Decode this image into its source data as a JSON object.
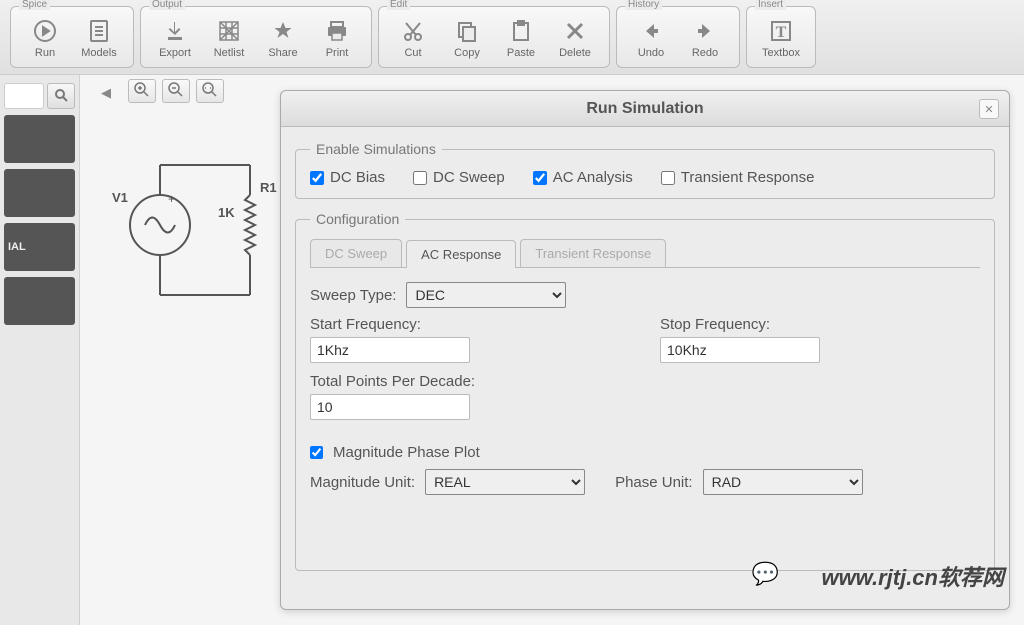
{
  "toolbar": {
    "groups": [
      {
        "label": "Spice",
        "items": [
          {
            "name": "run",
            "label": "Run"
          },
          {
            "name": "models",
            "label": "Models"
          }
        ]
      },
      {
        "label": "Output",
        "items": [
          {
            "name": "export",
            "label": "Export"
          },
          {
            "name": "netlist",
            "label": "Netlist"
          },
          {
            "name": "share",
            "label": "Share"
          },
          {
            "name": "print",
            "label": "Print"
          }
        ]
      },
      {
        "label": "Edit",
        "items": [
          {
            "name": "cut",
            "label": "Cut"
          },
          {
            "name": "copy",
            "label": "Copy"
          },
          {
            "name": "paste",
            "label": "Paste"
          },
          {
            "name": "delete",
            "label": "Delete"
          }
        ]
      },
      {
        "label": "History",
        "items": [
          {
            "name": "undo",
            "label": "Undo"
          },
          {
            "name": "redo",
            "label": "Redo"
          }
        ]
      },
      {
        "label": "Insert",
        "items": [
          {
            "name": "textbox",
            "label": "Textbox"
          }
        ]
      }
    ]
  },
  "sidebar": {
    "search_placeholder": "",
    "items": [
      "",
      "",
      "IAL",
      ""
    ]
  },
  "schematic": {
    "v1_label": "V1",
    "r1_label": "R1",
    "r1_value": "1K"
  },
  "dialog": {
    "title": "Run Simulation",
    "enable_legend": "Enable Simulations",
    "checks": {
      "dc_bias": {
        "label": "DC Bias",
        "checked": true
      },
      "dc_sweep": {
        "label": "DC Sweep",
        "checked": false
      },
      "ac_analysis": {
        "label": "AC Analysis",
        "checked": true
      },
      "transient": {
        "label": "Transient Response",
        "checked": false
      }
    },
    "config_legend": "Configuration",
    "tabs": {
      "dc_sweep": "DC Sweep",
      "ac_response": "AC Response",
      "transient": "Transient Response"
    },
    "sweep_type_label": "Sweep Type:",
    "sweep_type_value": "DEC",
    "start_freq_label": "Start Frequency:",
    "start_freq_value": "1Khz",
    "stop_freq_label": "Stop Frequency:",
    "stop_freq_value": "10Khz",
    "points_label": "Total Points Per Decade:",
    "points_value": "10",
    "mag_phase_check": {
      "label": "Magnitude Phase Plot",
      "checked": true
    },
    "mag_unit_label": "Magnitude Unit:",
    "mag_unit_value": "REAL",
    "phase_unit_label": "Phase Unit:",
    "phase_unit_value": "RAD"
  },
  "watermark": "www.rjtj.cn软荐网"
}
